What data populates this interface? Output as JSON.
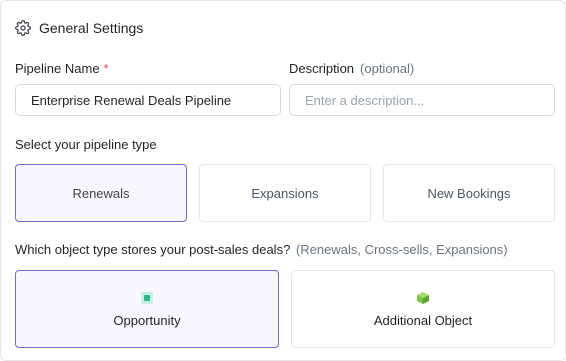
{
  "section": {
    "title": "General Settings",
    "icon": "gear-icon"
  },
  "pipeline_name": {
    "label": "Pipeline Name",
    "required_marker": "*",
    "value": "Enterprise Renewal Deals Pipeline"
  },
  "description": {
    "label": "Description",
    "optional_label": "(optional)",
    "placeholder": "Enter a description..."
  },
  "pipeline_type": {
    "label": "Select your pipeline type",
    "options": [
      {
        "label": "Renewals",
        "selected": true
      },
      {
        "label": "Expansions",
        "selected": false
      },
      {
        "label": "New Bookings",
        "selected": false
      }
    ]
  },
  "object_type": {
    "question": "Which object type stores your post-sales deals?",
    "hint": "(Renewals, Cross-sells, Expansions)",
    "options": [
      {
        "label": "Opportunity",
        "icon": "opportunity-icon",
        "selected": true
      },
      {
        "label": "Additional Object",
        "icon": "cube-icon",
        "selected": false
      }
    ]
  },
  "colors": {
    "accent": "#6f6acb",
    "required": "#e5484d",
    "opportunity_icon": "#2bb58a",
    "cube_icon": "#7cc242"
  }
}
